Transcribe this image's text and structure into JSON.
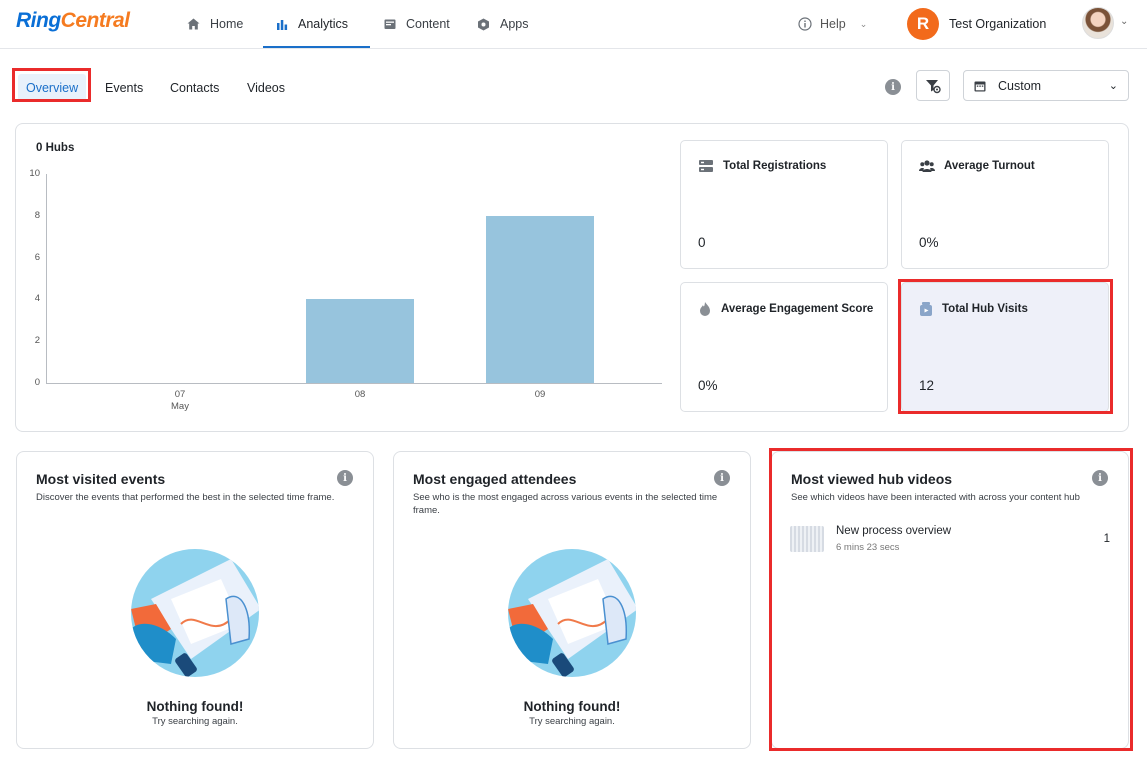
{
  "brand": {
    "logo_part1": "Ring",
    "logo_part2": "Central"
  },
  "nav": {
    "items": [
      {
        "label": "Home",
        "icon": "home-icon"
      },
      {
        "label": "Analytics",
        "icon": "bar-chart-icon"
      },
      {
        "label": "Content",
        "icon": "content-icon"
      },
      {
        "label": "Apps",
        "icon": "apps-icon"
      }
    ],
    "active": "Analytics",
    "help_label": "Help",
    "org_initial": "R",
    "org_name": "Test Organization"
  },
  "tabs": [
    "Overview",
    "Events",
    "Contacts",
    "Videos"
  ],
  "active_tab": "Overview",
  "date_filter": {
    "selected": "Custom"
  },
  "chart_data": {
    "type": "bar",
    "title": "0 Hubs",
    "categories": [
      "07",
      "08",
      "09"
    ],
    "category_sublabel": "May",
    "values": [
      0,
      4,
      8
    ],
    "ylim": [
      0,
      10
    ],
    "yticks": [
      0,
      2,
      4,
      6,
      8,
      10
    ],
    "grid": false,
    "bar_color": "#97c4dd"
  },
  "stats": [
    {
      "label": "Total Registrations",
      "value": "0",
      "icon": "registrations-icon"
    },
    {
      "label": "Average Turnout",
      "value": "0%",
      "icon": "people-icon"
    },
    {
      "label": "Average Engagement Score",
      "value": "0%",
      "icon": "flame-icon"
    },
    {
      "label": "Total Hub Visits",
      "value": "12",
      "icon": "hub-visits-icon"
    }
  ],
  "panels": {
    "events": {
      "title": "Most visited events",
      "description": "Discover the events that performed the best in the selected time frame.",
      "empty_title": "Nothing found!",
      "empty_sub": "Try searching again."
    },
    "attendees": {
      "title": "Most engaged attendees",
      "description": "See who is the most engaged across various events in the selected time frame.",
      "empty_title": "Nothing found!",
      "empty_sub": "Try searching again."
    },
    "videos": {
      "title": "Most viewed hub videos",
      "description": "See which videos have been interacted with across your content hub",
      "items": [
        {
          "name": "New process overview",
          "duration": "6 mins 23 secs",
          "count": "1"
        }
      ]
    }
  },
  "colors": {
    "accent": "#1a6fc9",
    "highlight_border": "#ea2b2b",
    "org_badge": "#f26a1b"
  }
}
